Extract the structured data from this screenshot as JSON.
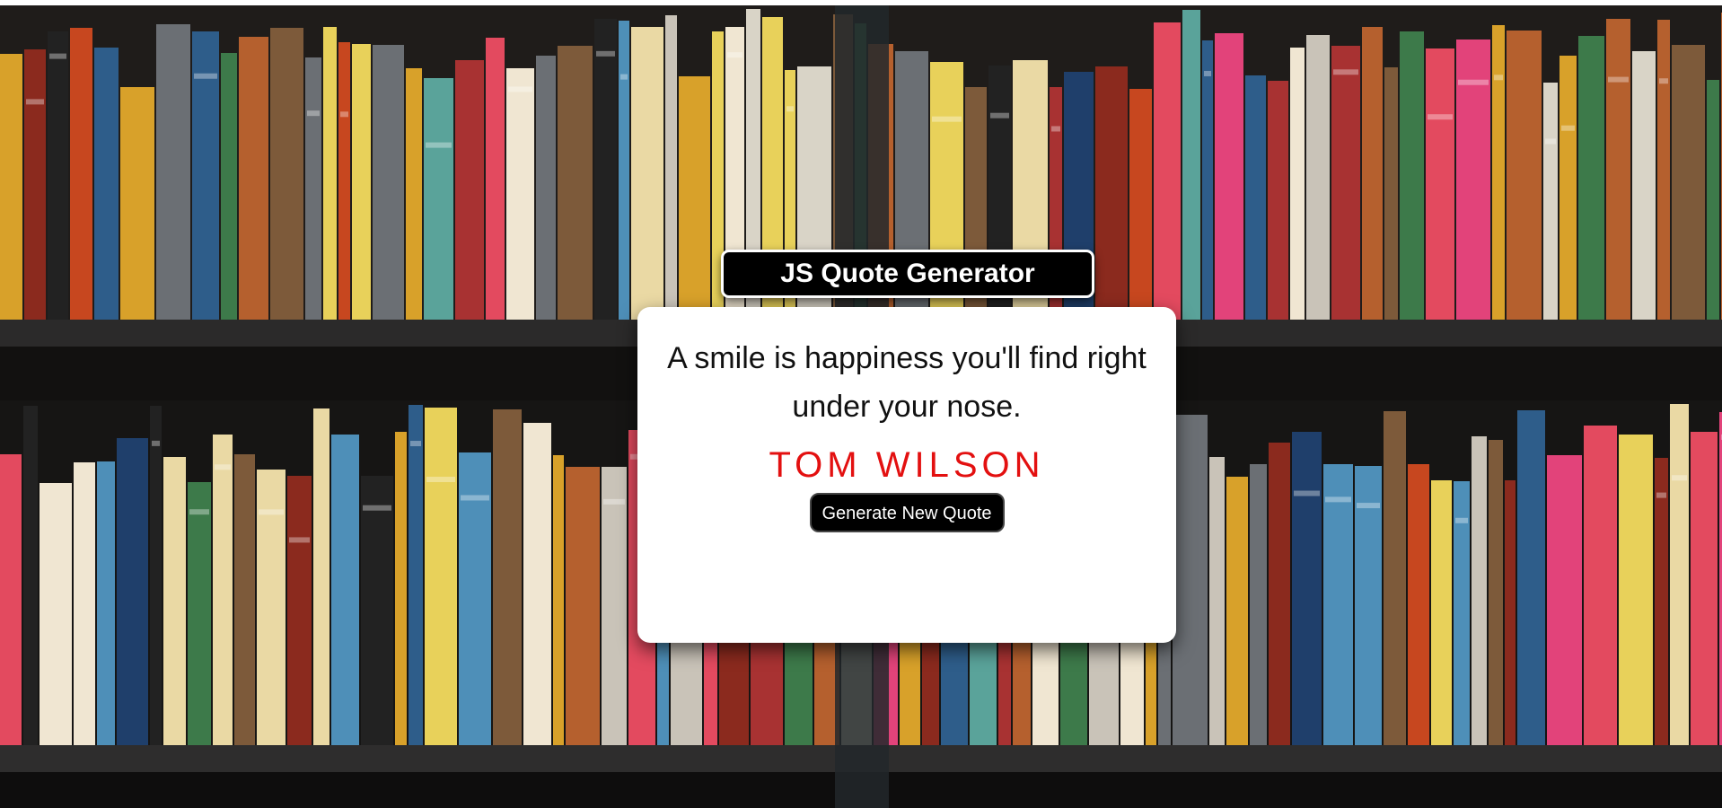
{
  "header": {
    "title": "JS Quote Generator"
  },
  "quote": {
    "text": "A smile is happiness you'll find right under your nose.",
    "author": "TOM WILSON"
  },
  "actions": {
    "generate_label": "Generate New Quote"
  },
  "colors": {
    "author": "#e31010",
    "button_bg": "#000000",
    "card_bg": "#ffffff"
  },
  "background": {
    "image_icon": "bookshelf-background"
  }
}
